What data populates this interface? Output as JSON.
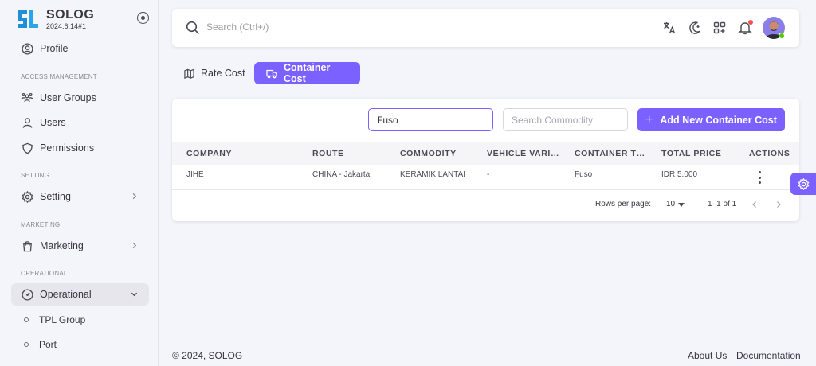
{
  "brand": {
    "name": "SOLOG",
    "version": "2024.6.14#1"
  },
  "sidebar": {
    "profile": "Profile",
    "sections": {
      "access": "ACCESS MANAGEMENT",
      "setting": "SETTING",
      "marketing": "MARKETING",
      "operational": "OPERATIONAL"
    },
    "items": {
      "user_groups": "User Groups",
      "users": "Users",
      "permissions": "Permissions",
      "setting": "Setting",
      "marketing": "Marketing",
      "operational": "Operational"
    },
    "sub_items": [
      "TPL Group",
      "Port"
    ]
  },
  "topbar": {
    "search_placeholder": "Search (Ctrl+/)"
  },
  "tabs": {
    "rate_cost": "Rate Cost",
    "container_cost": "Container Cost"
  },
  "filters": {
    "company_value": "Fuso",
    "commodity_placeholder": "Search Commodity",
    "add_button": "Add New Container Cost"
  },
  "table": {
    "headers": [
      "COMPANY",
      "ROUTE",
      "COMMODITY",
      "VEHICLE VARIA...",
      "CONTAINER TY...",
      "TOTAL PRICE",
      "ACTIONS"
    ],
    "rows": [
      {
        "company": "JIHE",
        "route": "CHINA - Jakarta",
        "commodity": "KERAMIK LANTAI",
        "vehicle_variant": "-",
        "container_type": "Fuso",
        "total_price": "IDR 5.000"
      }
    ]
  },
  "pagination": {
    "rows_per_page_label": "Rows per page:",
    "rows_per_page": "10",
    "range": "1–1 of 1"
  },
  "footer": {
    "copyright": "© 2024, SOLOG",
    "about": "About Us",
    "docs": "Documentation"
  },
  "colors": {
    "primary": "#7b61ff",
    "text": "#3a3541",
    "background": "#f4f5fa"
  }
}
